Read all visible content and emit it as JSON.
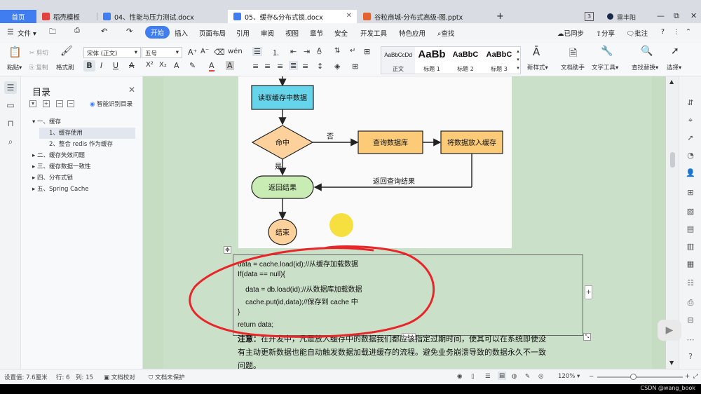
{
  "tabs": [
    {
      "label": "首页",
      "active": false,
      "icon": ""
    },
    {
      "label": "稻壳模板",
      "icon": "wps-logo-icon",
      "color": "#e2413d"
    },
    {
      "label": "04、性能与压力测试.docx",
      "icon": "word-doc-icon",
      "color": "#3f7df0"
    },
    {
      "label": "05、缓存&分布式锁.docx",
      "icon": "word-doc-icon",
      "color": "#3f7df0",
      "active": true
    },
    {
      "label": "谷粒商城-分布式高级-图.pptx",
      "icon": "ppt-icon",
      "color": "#e2632e"
    }
  ],
  "tab_new": "+",
  "window": {
    "badge": "3",
    "user": "雷丰阳"
  },
  "menu": {
    "file": "文件",
    "items": [
      "开始",
      "插入",
      "页面布局",
      "引用",
      "审阅",
      "视图",
      "章节",
      "安全",
      "开发工具",
      "特色应用",
      "查找"
    ],
    "active": "开始",
    "right": [
      "已同步",
      "分享",
      "批注"
    ]
  },
  "ribbon": {
    "paste": "粘贴",
    "cut": "剪切",
    "copy": "复制",
    "format_painter": "格式刷",
    "font_name": "宋体 (正文)",
    "font_size": "五号",
    "styles": [
      {
        "sample": "AaBbCcDd",
        "name": "正文"
      },
      {
        "sample": "AaBb",
        "name": "标题 1"
      },
      {
        "sample": "AaBbC",
        "name": "标题 2"
      },
      {
        "sample": "AaBbC",
        "name": "标题 3"
      }
    ],
    "new_style": "新样式",
    "doc_assistant": "文档助手",
    "text_tools": "文字工具",
    "find_replace": "查找替换",
    "select": "选择"
  },
  "toc": {
    "title": "目录",
    "smart": "智能识别目录",
    "items": [
      {
        "label": "一、缓存",
        "level": 1,
        "expanded": true
      },
      {
        "label": "1、缓存使用",
        "level": 2,
        "selected": true
      },
      {
        "label": "2、整合 redis 作为缓存",
        "level": 2
      },
      {
        "label": "二、缓存失效问题",
        "level": 1
      },
      {
        "label": "三、缓存数据一致性",
        "level": 1
      },
      {
        "label": "四、分布式锁",
        "level": 1
      },
      {
        "label": "五、Spring Cache",
        "level": 1
      }
    ]
  },
  "flowchart": {
    "read_cache": "读取缓存中数据",
    "hit": "命中",
    "no": "否",
    "query_db": "查询数据库",
    "put_cache": "将数据放入缓存",
    "yes": "是",
    "return_result": "返回结果",
    "return_query": "返回查询结果",
    "end": "结束"
  },
  "code_lines": [
    "data = cache.load(id);//从缓存加载数据",
    "If(data == null){",
    "    data = db.load(id);//从数据库加载数据",
    "    cache.put(id,data);//保存到 cache 中",
    "}",
    "return data;"
  ],
  "note": {
    "label": "注意：",
    "line1": "在开发中，凡是放入缓存中的数据我们都应该指定过期时间，使其可以在系统即使没",
    "line2": "有主动更新数据也能自动触发数据加载进缓存的流程。避免业务崩溃导致的数据永久不一致",
    "line3": "问题。"
  },
  "status": {
    "setting": "设置值: 7.6厘米",
    "row": "行: 6",
    "col": "列: 15",
    "proofread": "文档校对",
    "unprotected": "文档未保护",
    "zoom": "120%"
  },
  "watermark": "CSDN @wang_book",
  "colors": {
    "accent": "#3f7df0",
    "page_bg": "#cbe0c9",
    "annotation": "#e8262a",
    "cursor_highlight": "#f5dd2a"
  }
}
